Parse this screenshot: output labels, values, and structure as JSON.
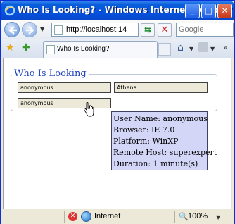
{
  "window": {
    "title": "Who Is Looking? - Windows Internet Explorer",
    "minimize_icon": "minimize-icon",
    "maximize_icon": "maximize-icon",
    "close_icon": "close-icon",
    "minimize_glyph": "_",
    "maximize_glyph": "□",
    "close_glyph": "✕"
  },
  "navbar": {
    "back_icon": "back-arrow-icon",
    "forward_icon": "forward-arrow-icon",
    "dropdown_glyph": "▼",
    "address": "http://localhost:14",
    "refresh_glyph": "⇆",
    "stop_glyph": "✕",
    "search_placeholder": "Google"
  },
  "tabbar": {
    "favorites_glyph": "★",
    "add_favorite_glyph": "✚",
    "active_tab_label": "Who Is Looking?",
    "home_glyph": "⌂",
    "dropdown_glyph": "▼",
    "more_glyph": "»"
  },
  "page": {
    "legend": "Who Is Looking",
    "users": [
      "anonymous",
      "Athena",
      "anonymous"
    ],
    "tooltip": {
      "user_name": "User Name: anonymous",
      "browser": "Browser: IE 7.0",
      "platform": "Platform: WinXP",
      "remote_host": "Remote Host: superexpert",
      "duration": "Duration: 1 minute(s)"
    }
  },
  "statusbar": {
    "blocked_glyph": "✕",
    "zone": "Internet",
    "zoom_glyph": "🔍",
    "zoom": "100%",
    "dropdown_glyph": "▼"
  },
  "colors": {
    "titlebar": "#0554e3",
    "legend_text": "#2146bc",
    "tooltip_bg": "#d4d6f8"
  }
}
